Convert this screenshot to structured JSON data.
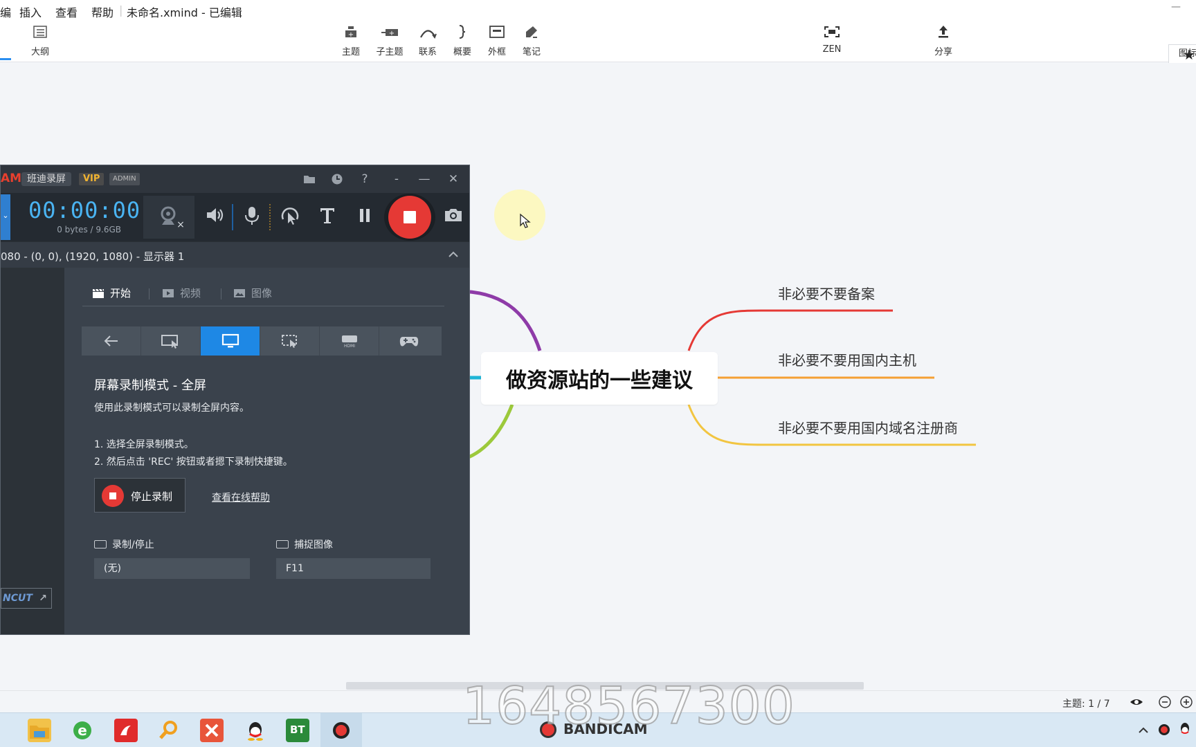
{
  "app": {
    "title": "未命名.xmind - 已编辑",
    "menu": [
      "编",
      "插入",
      "查看",
      "帮助"
    ]
  },
  "toolbar": {
    "outline": "大纲",
    "topic": "主题",
    "subtopic": "子主题",
    "relation": "联系",
    "summary": "概要",
    "boundary": "外框",
    "note": "笔记",
    "zen": "ZEN",
    "share": "分享",
    "icon_panel": "图标"
  },
  "mindmap": {
    "central": "做资源站的一些建议",
    "branches": [
      {
        "label": "非必要不要备案",
        "color": "#e53935"
      },
      {
        "label": "非必要不要用国内主机",
        "color": "#f5a033"
      },
      {
        "label": "非必要不要用国内域名注册商",
        "color": "#f2c541"
      }
    ],
    "left_branch_colors": [
      "#8e3ba8",
      "#1fb5d6",
      "#9cc93b"
    ]
  },
  "bandicam": {
    "logo": "AM",
    "name": "班迪录屏",
    "vip": "VIP",
    "admin": "ADMIN",
    "timer": "00:00:00",
    "size": "0 bytes / 9.6GB",
    "target": "080 - (0, 0), (1920, 1080) - 显示器 1",
    "tabs": [
      "开始",
      "视频",
      "图像"
    ],
    "mode_title": "屏幕录制模式 - 全屏",
    "mode_desc": "使用此录制模式可以录制全屏内容。",
    "step1": "1. 选择全屏录制模式。",
    "step2": "2. 然后点击 'REC' 按钮或者摁下录制快捷键。",
    "stop_button": "停止录制",
    "help_link": "查看在线帮助",
    "hotkey_record_label": "录制/停止",
    "hotkey_record_value": "(无)",
    "hotkey_capture_label": "捕捉图像",
    "hotkey_capture_value": "F11",
    "bandicut": "NCUT",
    "accent": "#1e88e5",
    "rec_color": "#e53935"
  },
  "status": {
    "topic_count": "主题: 1 / 7"
  },
  "watermark": "1648567300",
  "taskbar": {
    "bandicam_brand": "BANDICAM",
    "bt_label": "BT"
  }
}
